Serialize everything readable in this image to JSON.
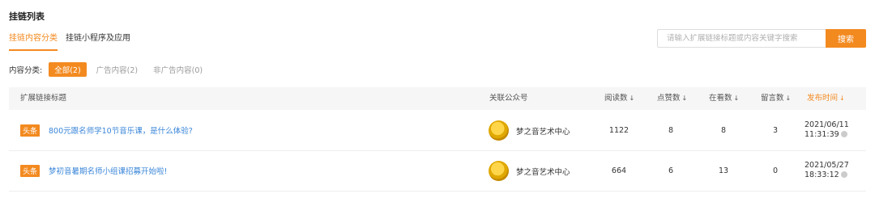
{
  "page": {
    "title": "挂链列表"
  },
  "tabs": [
    {
      "label": "挂链内容分类"
    },
    {
      "label": "挂链小程序及应用"
    }
  ],
  "search": {
    "placeholder": "请输入扩展链接标题或内容关键字搜索",
    "button_label": "搜索"
  },
  "filter": {
    "label": "内容分类:",
    "options": [
      {
        "label": "全部(2)",
        "selected": true
      },
      {
        "label": "广告内容(2)",
        "selected": false
      },
      {
        "label": "非广告内容(0)",
        "selected": false
      }
    ]
  },
  "table": {
    "columns": {
      "title": "扩展链接标题",
      "account": "关联公众号",
      "reads": "阅读数",
      "likes": "点赞数",
      "watching": "在看数",
      "comments": "留言数",
      "publish_time": "发布时间"
    },
    "sort_arrow": "↓",
    "rows": [
      {
        "badge": "头条",
        "title": "800元跟名师学10节音乐课，是什么体验?",
        "account": "梦之音艺术中心",
        "reads": "1122",
        "likes": "8",
        "watching": "8",
        "comments": "3",
        "date": "2021/06/11",
        "time": "11:31:39"
      },
      {
        "badge": "头条",
        "title": "梦初音暑期名师小组课招募开始啦!",
        "account": "梦之音艺术中心",
        "reads": "664",
        "likes": "6",
        "watching": "13",
        "comments": "0",
        "date": "2021/05/27",
        "time": "18:33:12"
      }
    ]
  },
  "colors": {
    "accent": "#f38a20",
    "link": "#3a86d9",
    "header_bg": "#f6f6f6"
  },
  "icons": {
    "sort": "arrow-down-icon",
    "status": "status-dot-icon",
    "avatar": "account-avatar"
  }
}
